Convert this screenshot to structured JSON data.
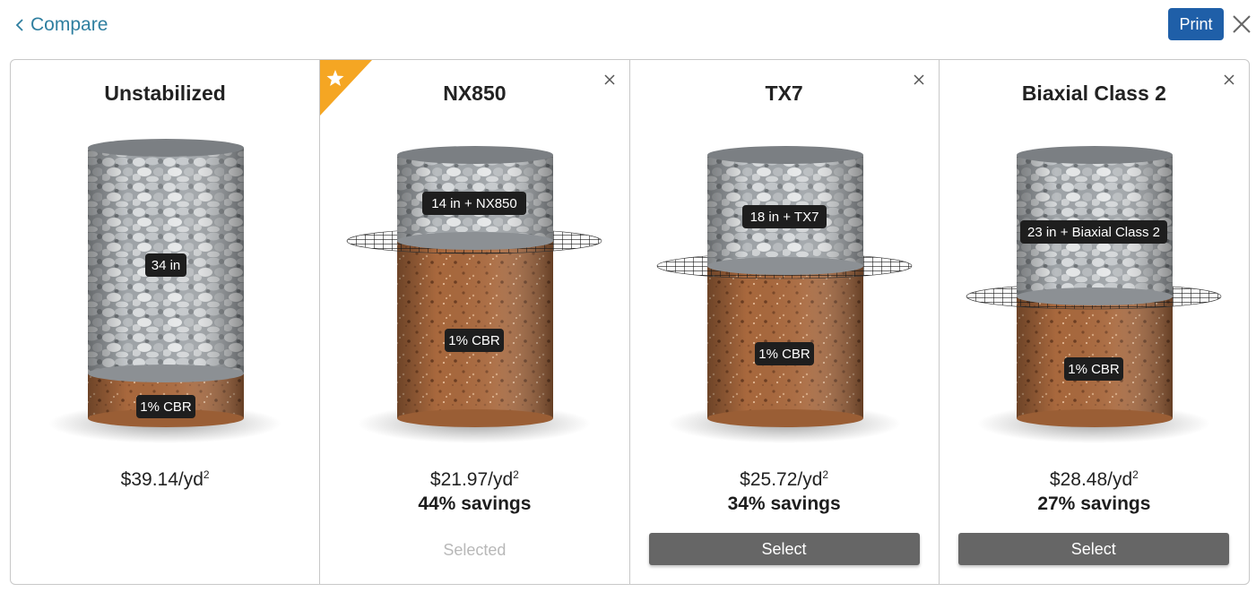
{
  "header": {
    "back_label": "Compare",
    "print_label": "Print"
  },
  "cards": [
    {
      "title": "Unstabilized",
      "aggregate_label": "34 in",
      "subgrade_label": "1% CBR",
      "price": "$39.14/yd",
      "price_unit_sup": "2",
      "savings": "",
      "action": ""
    },
    {
      "title": "NX850",
      "aggregate_label": "14 in + NX850",
      "subgrade_label": "1% CBR",
      "price": "$21.97/yd",
      "price_unit_sup": "2",
      "savings": "44% savings",
      "action": "Selected",
      "recommended": true
    },
    {
      "title": "TX7",
      "aggregate_label": "18 in + TX7",
      "subgrade_label": "1% CBR",
      "price": "$25.72/yd",
      "price_unit_sup": "2",
      "savings": "34% savings",
      "action": "Select"
    },
    {
      "title": "Biaxial Class 2",
      "aggregate_label": "23 in + Biaxial Class 2",
      "subgrade_label": "1% CBR",
      "price": "$28.48/yd",
      "price_unit_sup": "2",
      "savings": "27% savings",
      "action": "Select"
    }
  ],
  "colors": {
    "accent_blue": "#1f5fa8",
    "link_teal": "#2f7fa0",
    "star_orange": "#f5a623",
    "aggregate_gray": "#a9adb1",
    "subgrade_brown": "#a9673a",
    "select_button_gray": "#666666"
  },
  "icons": {
    "back": "chevron-left-icon",
    "close": "close-icon",
    "recommended": "star-icon"
  }
}
